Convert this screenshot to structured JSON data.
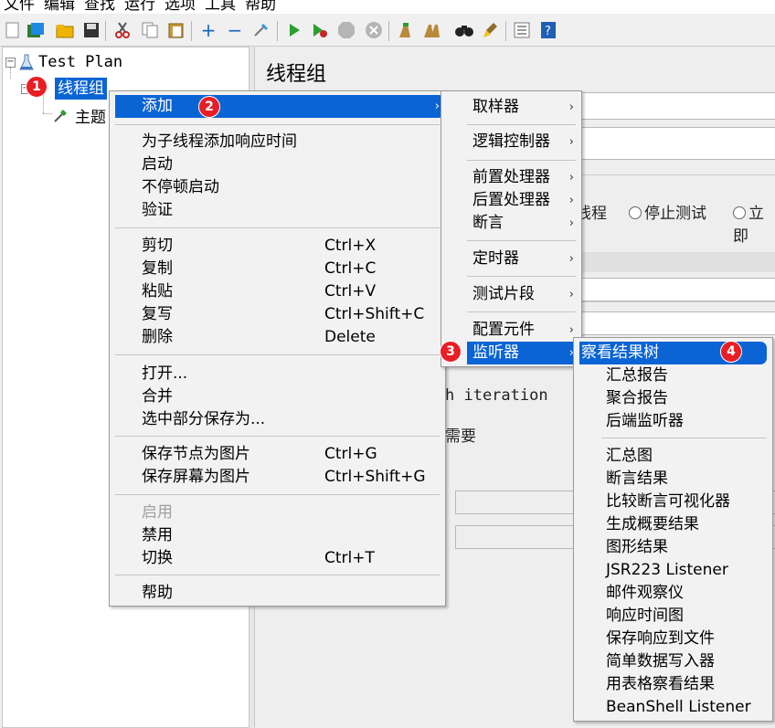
{
  "menubar": [
    "文件",
    "编辑",
    "查找",
    "运行",
    "选项",
    "工具",
    "帮助"
  ],
  "tree": {
    "root": "Test Plan",
    "thread_group": "线程组",
    "child": "主题"
  },
  "right_panel": {
    "title": "线程组",
    "on_error_thread": "线程",
    "on_error_stop_test": "停止测试",
    "on_error_stop_now": "立即",
    "iteration_fragment": "h iteration",
    "need_fragment": "需要"
  },
  "context_menu": {
    "add": "添加",
    "add_think_time": "为子线程添加响应时间",
    "start": "启动",
    "start_no_pause": "不停顿启动",
    "validate": "验证",
    "cut": "剪切",
    "cut_sc": "Ctrl+X",
    "copy": "复制",
    "copy_sc": "Ctrl+C",
    "paste": "粘贴",
    "paste_sc": "Ctrl+V",
    "duplicate": "复写",
    "duplicate_sc": "Ctrl+Shift+C",
    "delete": "删除",
    "delete_sc": "Delete",
    "open": "打开...",
    "merge": "合并",
    "save_selection_as": "选中部分保存为...",
    "save_node_image": "保存节点为图片",
    "save_node_image_sc": "Ctrl+G",
    "save_screen_image": "保存屏幕为图片",
    "save_screen_image_sc": "Ctrl+Shift+G",
    "enable": "启用",
    "disable": "禁用",
    "toggle": "切换",
    "toggle_sc": "Ctrl+T",
    "help": "帮助"
  },
  "add_submenu": {
    "sampler": "取样器",
    "logic_controller": "逻辑控制器",
    "pre_processors": "前置处理器",
    "post_processors": "后置处理器",
    "assertions": "断言",
    "timer": "定时器",
    "test_fragment": "测试片段",
    "config_element": "配置元件",
    "listener": "监听器"
  },
  "listener_submenu": [
    "察看结果树",
    "汇总报告",
    "聚合报告",
    "后端监听器",
    "汇总图",
    "断言结果",
    "比较断言可视化器",
    "生成概要结果",
    "图形结果",
    "JSR223 Listener",
    "邮件观察仪",
    "响应时间图",
    "保存响应到文件",
    "简单数据写入器",
    "用表格察看结果",
    "BeanShell Listener"
  ],
  "badges": [
    "1",
    "2",
    "3",
    "4"
  ],
  "colors": {
    "highlight": "#0a64d4",
    "badge": "#e81e25"
  }
}
